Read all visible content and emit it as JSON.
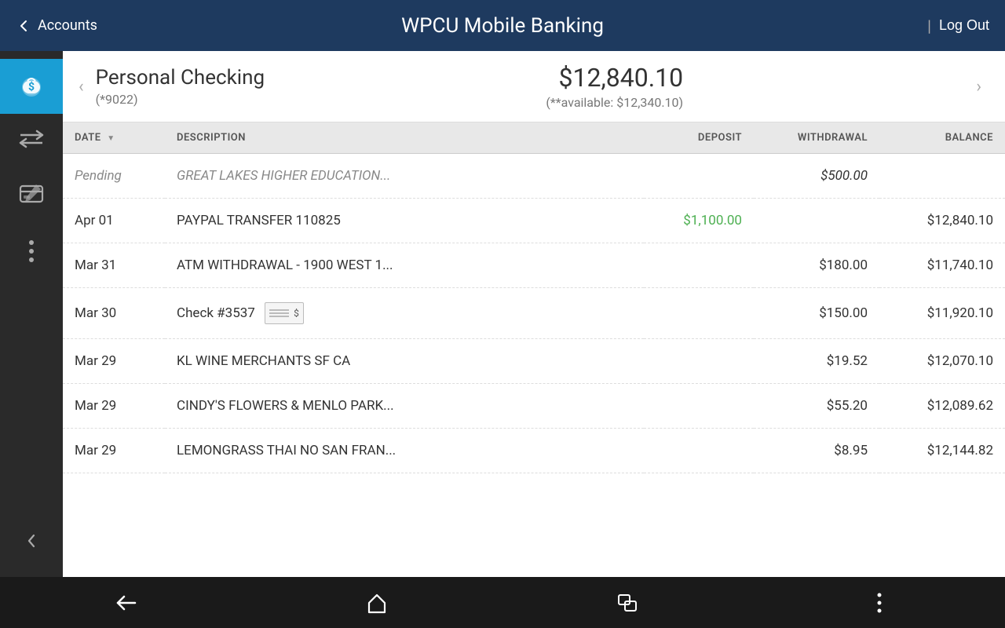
{
  "app": {
    "title": "WPCU Mobile Banking",
    "back_label": "Accounts",
    "logout_label": "Log Out"
  },
  "account": {
    "name": "Personal Checking",
    "number": "(*9022)",
    "balance": "$12,840.10",
    "available_label": "(**available: $12,340.10)"
  },
  "table": {
    "headers": {
      "date": "DATE",
      "description": "DESCRIPTION",
      "deposit": "DEPOSIT",
      "withdrawal": "WITHDRAWAL",
      "balance": "BALANCE"
    },
    "rows": [
      {
        "date": "Pending",
        "description": "GREAT LAKES HIGHER EDUCATION...",
        "deposit": "",
        "withdrawal": "$500.00",
        "balance": "",
        "pending": true,
        "has_check": false
      },
      {
        "date": "Apr 01",
        "description": "PAYPAL TRANSFER 110825",
        "deposit": "$1,100.00",
        "withdrawal": "",
        "balance": "$12,840.10",
        "pending": false,
        "has_check": false,
        "deposit_green": true
      },
      {
        "date": "Mar 31",
        "description": "ATM WITHDRAWAL - 1900 WEST 1...",
        "deposit": "",
        "withdrawal": "$180.00",
        "balance": "$11,740.10",
        "pending": false,
        "has_check": false
      },
      {
        "date": "Mar 30",
        "description": "Check #3537",
        "deposit": "",
        "withdrawal": "$150.00",
        "balance": "$11,920.10",
        "pending": false,
        "has_check": true
      },
      {
        "date": "Mar 29",
        "description": "KL WINE MERCHANTS SF CA",
        "deposit": "",
        "withdrawal": "$19.52",
        "balance": "$12,070.10",
        "pending": false,
        "has_check": false
      },
      {
        "date": "Mar 29",
        "description": "CINDY'S FLOWERS & MENLO PARK...",
        "deposit": "",
        "withdrawal": "$55.20",
        "balance": "$12,089.62",
        "pending": false,
        "has_check": false
      },
      {
        "date": "Mar 29",
        "description": "LEMONGRASS THAI NO SAN FRAN...",
        "deposit": "",
        "withdrawal": "$8.95",
        "balance": "$12,144.82",
        "pending": false,
        "has_check": false
      }
    ]
  },
  "sidebar": {
    "items": [
      {
        "id": "accounts",
        "label": "Accounts",
        "active": true
      },
      {
        "id": "transfers",
        "label": "Transfers",
        "active": false
      },
      {
        "id": "pay",
        "label": "Pay",
        "active": false
      },
      {
        "id": "more",
        "label": "More",
        "active": false
      }
    ]
  },
  "bottom_nav": {
    "back_label": "Back",
    "home_label": "Home",
    "recent_label": "Recent Apps",
    "more_label": "More"
  },
  "colors": {
    "nav_bg": "#1e3a5f",
    "sidebar_bg": "#2a2a2a",
    "active_item": "#1a9ed4",
    "deposit_green": "#4CAF50",
    "bottom_bg": "#1a1a1a"
  }
}
